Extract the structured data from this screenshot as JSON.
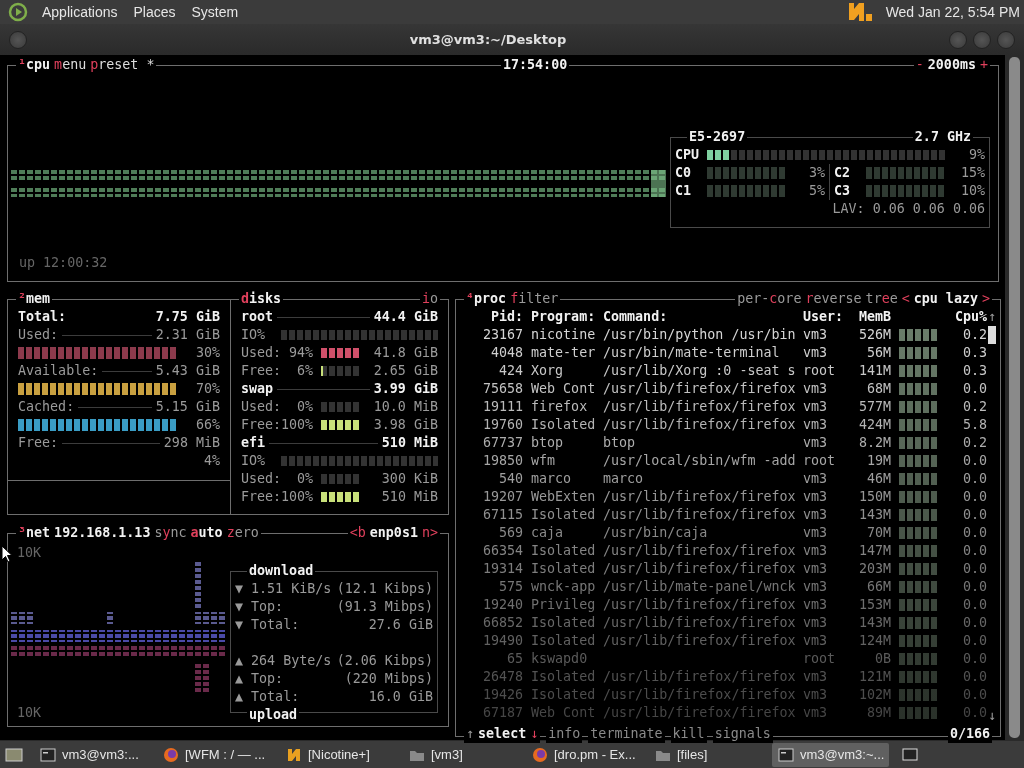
{
  "top_panel": {
    "menus": [
      "Applications",
      "Places",
      "System"
    ],
    "clock": "Wed Jan 22, 5:54 PM"
  },
  "window": {
    "title": "vm3@vm3:~/Desktop"
  },
  "cpu_box": {
    "header": [
      {
        "kind": "title",
        "key": "¹",
        "rest": "cpu"
      },
      {
        "kind": "option",
        "key": "m",
        "rest": "enu"
      },
      {
        "kind": "option",
        "key": "p",
        "rest": "reset *"
      }
    ],
    "clock": "17:54:00",
    "rate": {
      "minus": "-",
      "value": "2000ms",
      "plus": "+"
    },
    "uptime": "up 12:00:32",
    "info": {
      "model": "E5-2697",
      "freq": "2.7 GHz",
      "total": {
        "label": "CPU",
        "level": 0.09,
        "reading": "9%"
      },
      "cores": [
        {
          "label": "C0",
          "reading": "3%"
        },
        {
          "label": "C1",
          "reading": "5%"
        },
        {
          "label": "C2",
          "reading": "15%"
        },
        {
          "label": "C3",
          "reading": "10%"
        }
      ],
      "load": "LAV: 0.06 0.06 0.06"
    }
  },
  "mem_box": {
    "title": {
      "key": "²",
      "rest": "mem"
    },
    "total": {
      "label": "Total:",
      "value": "7.75 GiB"
    },
    "stats": [
      {
        "label": "Used:",
        "value": "2.31 GiB",
        "percent": "30%",
        "color": "#8c3a4c"
      },
      {
        "label": "Available:",
        "value": "5.43 GiB",
        "percent": "70%",
        "color": "#c9a040"
      },
      {
        "label": "Cached:",
        "value": "5.15 GiB",
        "percent": "66%",
        "color": "#3a9cc4"
      },
      {
        "label": "Free:",
        "value": "298 MiB",
        "percent": "4%"
      }
    ]
  },
  "disks_box": {
    "title": {
      "key": "d",
      "rest": "isks"
    },
    "io_toggle": {
      "key": "i",
      "rest": "o"
    },
    "disks": [
      {
        "name": "root",
        "size": "44.4 GiB",
        "rows": [
          {
            "kind": "io",
            "label": "IO%",
            "level": 0
          },
          {
            "kind": "usage",
            "label": "Used:",
            "percent": "94%",
            "level": 0.94,
            "value": "41.8 GiB",
            "color": "#d0506a"
          },
          {
            "kind": "usage",
            "label": "Free:",
            "percent": "6%",
            "level": 0.06,
            "value": "2.65 GiB",
            "color": "#c8e07a"
          }
        ]
      },
      {
        "name": "swap",
        "size": "3.99 GiB",
        "rows": [
          {
            "kind": "usage",
            "label": "Used:",
            "percent": "0%",
            "level": 0,
            "value": "10.0 MiB"
          },
          {
            "kind": "usage",
            "label": "Free:",
            "percent": "100%",
            "level": 1,
            "value": "3.98 GiB",
            "color": "#c8e07a"
          }
        ]
      },
      {
        "name": "efi",
        "size": "510 MiB",
        "rows": [
          {
            "kind": "io",
            "label": "IO%",
            "level": 0
          },
          {
            "kind": "usage",
            "label": "Used:",
            "percent": "0%",
            "level": 0,
            "value": "300 KiB"
          },
          {
            "kind": "usage",
            "label": "Free:",
            "percent": "100%",
            "level": 1,
            "value": "510 MiB",
            "color": "#c8e07a"
          }
        ]
      }
    ]
  },
  "net_box": {
    "title": {
      "key": "³",
      "rest": "net"
    },
    "address": "192.168.1.13",
    "toggles": [
      {
        "pre": "s",
        "key": "y",
        "rest": "nc",
        "on": false
      },
      {
        "key": "a",
        "rest": "uto",
        "on": true
      },
      {
        "key": "z",
        "rest": "ero",
        "on": false
      }
    ],
    "interface": {
      "prev": "<b",
      "name": "enp0s1",
      "next": "n>"
    },
    "scale_top": "10K",
    "scale_bottom": "10K",
    "download": {
      "title": "download",
      "rows": [
        {
          "arrow": "▼",
          "label": "1.51 KiB/s",
          "value": "(12.1 Kibps)"
        },
        {
          "arrow": "▼",
          "label": "Top:",
          "value": "(91.3 Mibps)"
        },
        {
          "arrow": "▼",
          "label": "Total:",
          "value": "27.6 GiB"
        }
      ]
    },
    "upload": {
      "title": "upload",
      "rows": [
        {
          "arrow": "▲",
          "label": "264 Byte/s",
          "value": "(2.06 Kibps)"
        },
        {
          "arrow": "▲",
          "label": "Top:",
          "value": "(220 Mibps)"
        },
        {
          "arrow": "▲",
          "label": "Total:",
          "value": "16.0 GiB"
        }
      ]
    }
  },
  "proc_box": {
    "title": {
      "key": "⁴",
      "rest": "proc"
    },
    "filter": {
      "key": "f",
      "rest": "ilter"
    },
    "options": [
      {
        "pre": "per-",
        "key": "c",
        "rest": "ore",
        "on": false
      },
      {
        "key": "r",
        "rest": "everse",
        "on": false
      },
      {
        "pre": "tr",
        "key": "e",
        "rest": "e",
        "on": false
      }
    ],
    "sort": {
      "prev": "<",
      "name": "cpu lazy",
      "next": ">"
    },
    "columns": [
      "Pid:",
      "Program:",
      "Command:",
      "User:",
      "MemB",
      "Cpu%"
    ],
    "rows": [
      {
        "pid": "23167",
        "program": "nicotine",
        "command": "/usr/bin/python /usr/bin",
        "user": "vm3",
        "mem": "526M",
        "cpu": "0.2"
      },
      {
        "pid": "4048",
        "program": "mate-ter",
        "command": "/usr/bin/mate-terminal",
        "user": "vm3",
        "mem": "56M",
        "cpu": "0.3"
      },
      {
        "pid": "424",
        "program": "Xorg",
        "command": "/usr/lib/Xorg :0 -seat s",
        "user": "root",
        "mem": "141M",
        "cpu": "0.3"
      },
      {
        "pid": "75658",
        "program": "Web Cont",
        "command": "/usr/lib/firefox/firefox",
        "user": "vm3",
        "mem": "68M",
        "cpu": "0.0"
      },
      {
        "pid": "19111",
        "program": "firefox",
        "command": "/usr/lib/firefox/firefox",
        "user": "vm3",
        "mem": "577M",
        "cpu": "0.2"
      },
      {
        "pid": "19760",
        "program": "Isolated",
        "command": "/usr/lib/firefox/firefox",
        "user": "vm3",
        "mem": "424M",
        "cpu": "5.8"
      },
      {
        "pid": "67737",
        "program": "btop",
        "command": "btop",
        "user": "vm3",
        "mem": "8.2M",
        "cpu": "0.2"
      },
      {
        "pid": "19850",
        "program": "wfm",
        "command": "/usr/local/sbin/wfm -add",
        "user": "root",
        "mem": "19M",
        "cpu": "0.0"
      },
      {
        "pid": "540",
        "program": "marco",
        "command": "marco",
        "user": "vm3",
        "mem": "46M",
        "cpu": "0.0"
      },
      {
        "pid": "19207",
        "program": "WebExten",
        "command": "/usr/lib/firefox/firefox",
        "user": "vm3",
        "mem": "150M",
        "cpu": "0.0"
      },
      {
        "pid": "67115",
        "program": "Isolated",
        "command": "/usr/lib/firefox/firefox",
        "user": "vm3",
        "mem": "143M",
        "cpu": "0.0"
      },
      {
        "pid": "569",
        "program": "caja",
        "command": "/usr/bin/caja",
        "user": "vm3",
        "mem": "70M",
        "cpu": "0.0"
      },
      {
        "pid": "66354",
        "program": "Isolated",
        "command": "/usr/lib/firefox/firefox",
        "user": "vm3",
        "mem": "147M",
        "cpu": "0.0"
      },
      {
        "pid": "19314",
        "program": "Isolated",
        "command": "/usr/lib/firefox/firefox",
        "user": "vm3",
        "mem": "203M",
        "cpu": "0.0"
      },
      {
        "pid": "575",
        "program": "wnck-app",
        "command": "/usr/lib/mate-panel/wnck",
        "user": "vm3",
        "mem": "66M",
        "cpu": "0.0"
      },
      {
        "pid": "19240",
        "program": "Privileg",
        "command": "/usr/lib/firefox/firefox",
        "user": "vm3",
        "mem": "153M",
        "cpu": "0.0"
      },
      {
        "pid": "66852",
        "program": "Isolated",
        "command": "/usr/lib/firefox/firefox",
        "user": "vm3",
        "mem": "143M",
        "cpu": "0.0"
      },
      {
        "pid": "19490",
        "program": "Isolated",
        "command": "/usr/lib/firefox/firefox",
        "user": "vm3",
        "mem": "124M",
        "cpu": "0.0"
      },
      {
        "pid": "65",
        "program": "kswapd0",
        "user": "root",
        "mem": "0B",
        "cpu": "0.0"
      },
      {
        "pid": "26478",
        "program": "Isolated",
        "command": "/usr/lib/firefox/firefox",
        "user": "vm3",
        "mem": "121M",
        "cpu": "0.0"
      },
      {
        "pid": "19426",
        "program": "Isolated",
        "command": "/usr/lib/firefox/firefox",
        "user": "vm3",
        "mem": "102M",
        "cpu": "0.0"
      },
      {
        "pid": "67187",
        "program": "Web Cont",
        "command": "/usr/lib/firefox/firefox",
        "user": "vm3",
        "mem": "89M",
        "cpu": "0.0"
      }
    ],
    "scroll": {
      "up": "↑",
      "down": "↓"
    },
    "footer": {
      "select": {
        "up": "↑",
        "label": "select",
        "down": "↓"
      },
      "actions": [
        "info",
        "terminate",
        "kill",
        "signals"
      ],
      "count": "0/166"
    }
  },
  "taskbar": {
    "items": [
      {
        "label": "vm3@vm3:...",
        "kind": "terminal",
        "selected": false
      },
      {
        "label": "[WFM : / — ...",
        "kind": "browser",
        "selected": false
      },
      {
        "label": "[Nicotine+]",
        "kind": "nicotine",
        "selected": false
      },
      {
        "label": "[vm3]",
        "kind": "folder",
        "selected": false
      },
      {
        "label": "[dro.pm - Ex...",
        "kind": "browser",
        "selected": false
      },
      {
        "label": "[files]",
        "kind": "folder",
        "selected": false
      },
      {
        "label": "vm3@vm3:~...",
        "kind": "terminal",
        "selected": true
      }
    ]
  }
}
